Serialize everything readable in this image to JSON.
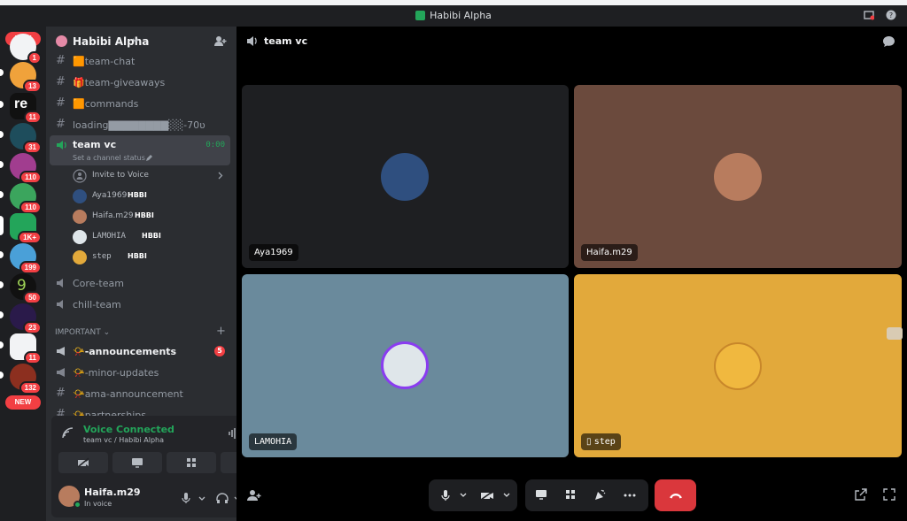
{
  "window": {
    "title": "Habibi Alpha"
  },
  "servers": {
    "new_tag_top": "NEW",
    "new_tag_bottom": "NEW",
    "badges": [
      "1",
      "13",
      "11",
      "31",
      "110",
      "110",
      "1K+",
      "199",
      "50",
      "23",
      "11",
      "132"
    ]
  },
  "server": {
    "name": "Habibi Alpha"
  },
  "channels": [
    {
      "label": "🟧team-chat"
    },
    {
      "label": "🎁team-giveaways"
    },
    {
      "label": "🟧commands"
    },
    {
      "label": "loading▇▇▇▇▇▇▇▇░░-70ʋ"
    }
  ],
  "voice_channel": {
    "name": "team vc",
    "timer": "0:00",
    "status_placeholder": "Set a channel status",
    "invite_label": "Invite to Voice",
    "members": [
      {
        "name": "Aya1969",
        "tag": "HBBI"
      },
      {
        "name": "Haifa.m29",
        "tag": "HBBI"
      },
      {
        "name": "LAMOHIA",
        "tag": "HBBI"
      },
      {
        "name": "step",
        "tag": "HBBI"
      }
    ]
  },
  "other_voice": [
    {
      "label": "Core-team"
    },
    {
      "label": "chill-team"
    }
  ],
  "category": {
    "label": "IMPORTANT"
  },
  "important_channels": [
    {
      "label": "📯-announcements",
      "unread": "5"
    },
    {
      "label": "📯-minor-updates"
    },
    {
      "label": "📯ama-announcement"
    },
    {
      "label": "📯partnerships"
    }
  ],
  "voice_panel": {
    "title": "Voice Connected",
    "subtitle": "team vc / Habibi Alpha"
  },
  "user": {
    "name": "Haifa.m29",
    "status": "In voice"
  },
  "main": {
    "channel_name": "team vc",
    "tiles": [
      {
        "name": "Aya1969",
        "color": "#1e1f22"
      },
      {
        "name": "Haifa.m29",
        "color": "#6b4a3d"
      },
      {
        "name": "LAMOHIA",
        "color": "#6a8a9c"
      },
      {
        "name": "step",
        "color": "#e2a93b"
      }
    ]
  },
  "colors": {
    "accent_green": "#23a55a",
    "danger": "#da373c",
    "badge_red": "#f23f43"
  }
}
